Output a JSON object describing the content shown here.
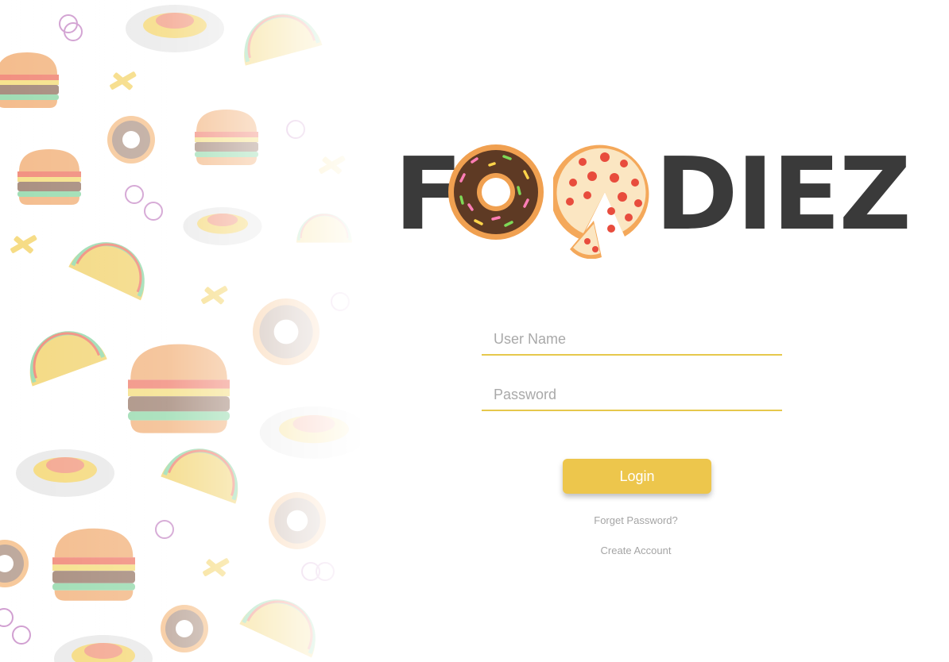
{
  "brand": {
    "name": "FOODIEZ",
    "letter_first": "F",
    "letters_rest": "DIEZ",
    "text_color": "#3a3a3a"
  },
  "form": {
    "username_placeholder": "User Name",
    "password_placeholder": "Password",
    "login_label": "Login",
    "forgot_label": "Forget Password?",
    "create_label": "Create Account"
  },
  "colors": {
    "accent": "#edc64c",
    "underline": "#e6c84c",
    "link": "#a5a5a5",
    "donut_icing": "#5e3a24",
    "donut_dough": "#f0a050",
    "pizza_crust": "#f4a85a",
    "pepperoni": "#e84c3d"
  },
  "icons": [
    "donut-icon",
    "pizza-icon",
    "burger-icon",
    "taco-icon",
    "pasta-plate-icon",
    "fries-icon",
    "onion-ring-icon"
  ]
}
